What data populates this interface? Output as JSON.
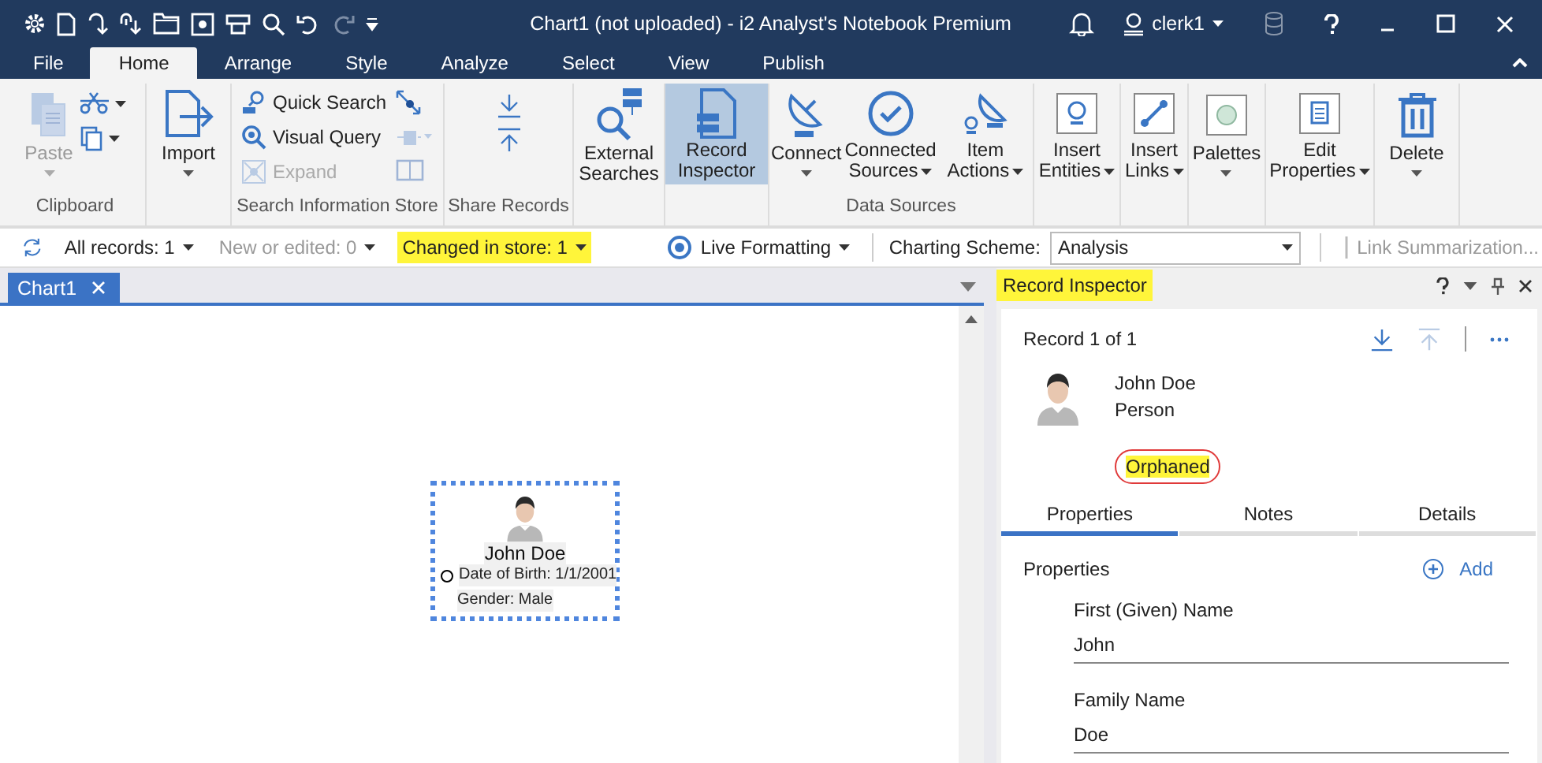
{
  "window": {
    "title": "Chart1 (not uploaded) - i2 Analyst's Notebook Premium",
    "user": "clerk1"
  },
  "ribbon_tabs": [
    {
      "label": "File",
      "selected": false
    },
    {
      "label": "Home",
      "selected": true
    },
    {
      "label": "Arrange",
      "selected": false
    },
    {
      "label": "Style",
      "selected": false
    },
    {
      "label": "Analyze",
      "selected": false
    },
    {
      "label": "Select",
      "selected": false
    },
    {
      "label": "View",
      "selected": false
    },
    {
      "label": "Publish",
      "selected": false
    }
  ],
  "ribbon_groups": [
    {
      "label": "Clipboard",
      "buttons": [
        {
          "label": "Paste",
          "disabled": true,
          "selected": false,
          "kind": "menu"
        }
      ]
    },
    {
      "buttons": [
        {
          "label": "Import",
          "disabled": false,
          "selected": false,
          "kind": "menu"
        }
      ]
    },
    {
      "label": "Search Information Store",
      "buttons": [
        {
          "label": "Quick Search",
          "disabled": false
        },
        {
          "label": "Visual Query",
          "disabled": false
        },
        {
          "label": "Expand",
          "disabled": true
        }
      ]
    },
    {
      "label": "Share Records"
    },
    {
      "buttons": [
        {
          "label": "External Searches",
          "disabled": false,
          "selected": false,
          "kind": "plain"
        }
      ]
    },
    {
      "buttons": [
        {
          "label": "Record Inspector",
          "disabled": false,
          "selected": true,
          "kind": "plain"
        }
      ]
    },
    {
      "label": "Data Sources",
      "buttons": [
        {
          "label": "Connect",
          "disabled": false,
          "selected": false,
          "kind": "menu"
        },
        {
          "label": "Connected Sources",
          "disabled": false,
          "selected": false,
          "kind": "inline-menu"
        },
        {
          "label": "Item Actions",
          "disabled": false,
          "selected": false,
          "kind": "inline-menu"
        }
      ]
    },
    {
      "buttons": [
        {
          "label": "Insert Entities",
          "disabled": false,
          "selected": false,
          "kind": "inline-menu"
        }
      ]
    },
    {
      "buttons": [
        {
          "label": "Insert Links",
          "disabled": false,
          "selected": false,
          "kind": "inline-menu"
        }
      ]
    },
    {
      "buttons": [
        {
          "label": "Palettes",
          "disabled": false,
          "selected": false,
          "kind": "menu"
        }
      ]
    },
    {
      "buttons": [
        {
          "label": "Edit Properties",
          "disabled": false,
          "selected": false,
          "kind": "inline-menu"
        }
      ]
    },
    {
      "buttons": [
        {
          "label": "Delete",
          "disabled": false,
          "selected": false,
          "kind": "menu"
        }
      ]
    }
  ],
  "record_filters": [
    {
      "label": "All records: 1",
      "disabled": false,
      "highlighted": false
    },
    {
      "label": "New or edited: 0",
      "disabled": true,
      "highlighted": false
    },
    {
      "label": "Changed in store: 1",
      "disabled": false,
      "highlighted": true
    }
  ],
  "live_formatting": {
    "label": "Live Formatting"
  },
  "charting_scheme": {
    "label": "Charting Scheme:",
    "value": "Analysis"
  },
  "link_summarization": {
    "label": "Link Summarization...",
    "disabled": true
  },
  "document_tabs": [
    {
      "label": "Chart1",
      "selected": true
    }
  ],
  "chart_node": {
    "label": "John Doe",
    "properties": [
      {
        "text": "Date of Birth: 1/1/2001",
        "marked": true
      },
      {
        "text": "Gender: Male",
        "marked": false
      }
    ]
  },
  "inspector": {
    "title": "Record Inspector",
    "highlighted": true,
    "record_count": "Record 1 of 1",
    "record_name": "John Doe",
    "record_type": "Person",
    "status": {
      "label": "Orphaned",
      "highlighted": true
    },
    "tabs": [
      {
        "label": "Properties",
        "selected": true
      },
      {
        "label": "Notes",
        "selected": false
      },
      {
        "label": "Details",
        "selected": false
      }
    ],
    "section": "Properties",
    "add_label": "Add",
    "fields": [
      {
        "label": "First (Given) Name",
        "value": "John"
      },
      {
        "label": "Family Name",
        "value": "Doe"
      }
    ]
  }
}
